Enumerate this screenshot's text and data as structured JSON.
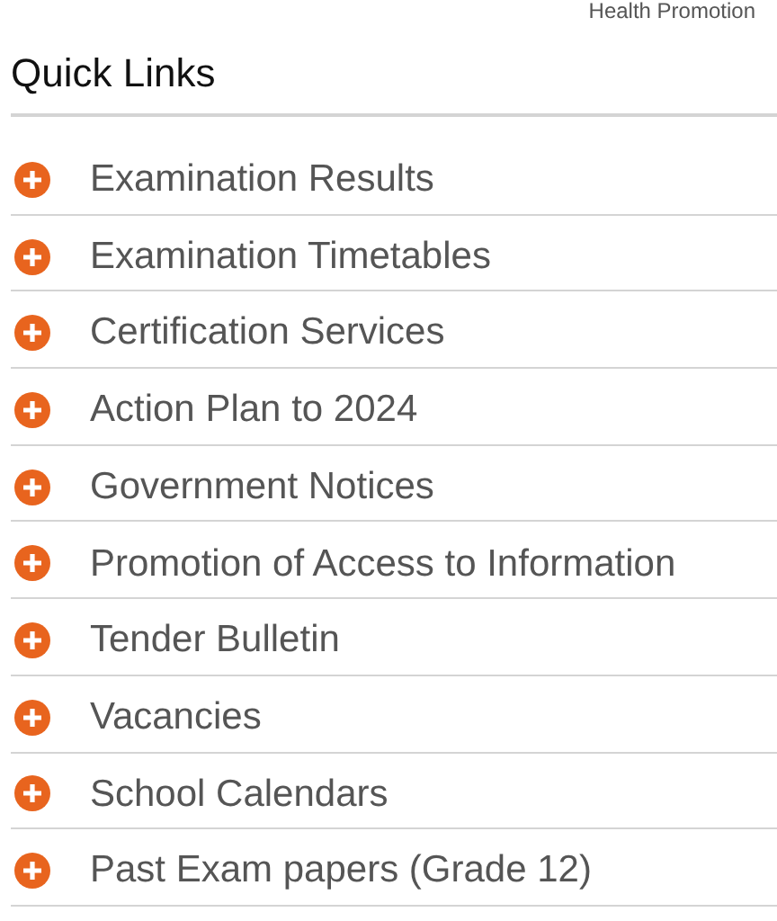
{
  "top_link": "Health Promotion",
  "section": {
    "title": "Quick Links"
  },
  "links": [
    {
      "label": "Examination Results"
    },
    {
      "label": "Examination Timetables"
    },
    {
      "label": "Certification Services"
    },
    {
      "label": "Action Plan to 2024"
    },
    {
      "label": "Government Notices"
    },
    {
      "label": "Promotion of Access to Information"
    },
    {
      "label": "Tender Bulletin"
    },
    {
      "label": "Vacancies"
    },
    {
      "label": "School Calendars"
    },
    {
      "label": "Past Exam papers (Grade 12)"
    }
  ]
}
